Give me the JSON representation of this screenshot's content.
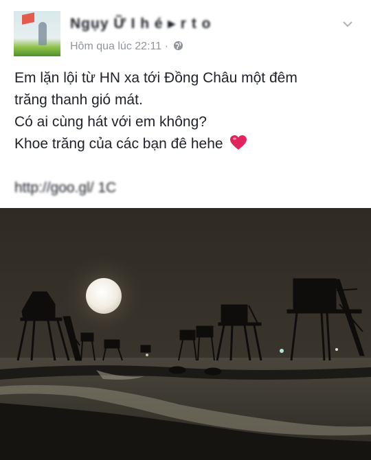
{
  "post": {
    "author_name": "Ngụy Ữ I  h   é  ▸  r  t  o",
    "timestamp": "Hôm qua lúc 22:11",
    "separator": "·",
    "privacy_icon": "globe-icon",
    "menu_icon": "chevron-down-icon",
    "lines": [
      "Em lặn lội từ HN xa tới Đồng Châu một đêm",
      "trăng thanh gió mát.",
      "Có ai cùng hát với em không?",
      "Khoe trăng của các bạn đê hehe"
    ],
    "emoji": "heart-icon",
    "link_text": "http://goo.gl/  1C"
  },
  "colors": {
    "text": "#1d2129",
    "meta": "#90949c",
    "heart": "#e0245e",
    "sky": "#3a342a",
    "moon": "#f4f1e8"
  }
}
